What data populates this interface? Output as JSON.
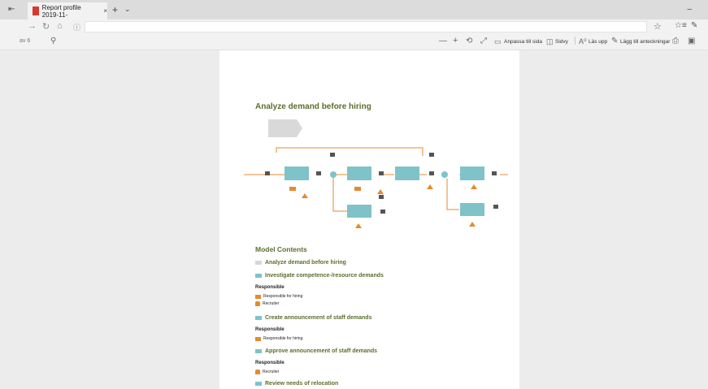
{
  "browser": {
    "tab_title": "Report profile 2019-11-",
    "tab_close": "×",
    "new_tab": "+",
    "tab_list": "⌄",
    "minimize": "–"
  },
  "pdf_toolbar": {
    "page_indicator": "av 6",
    "zoom_out": "—",
    "zoom_in": "+",
    "rotate": "⟲",
    "fit_label": "Anpassa till sida",
    "layout_label": "Sidvy",
    "read_aloud_label": "Läs upp",
    "annotations_label": "Lägg till anteckningar"
  },
  "document": {
    "title": "Analyze demand before hiring",
    "model_contents_heading": "Model Contents",
    "colors": {
      "heading": "#5a6e2c",
      "process": "#d6d6d6",
      "activity": "#7fc3c9",
      "person": "#e58a2e"
    },
    "items": [
      {
        "label": "Analyze demand before hiring",
        "kind": "process"
      },
      {
        "label": "Investigate competence-/resource demands",
        "kind": "activity",
        "responsible_heading": "Responsible",
        "responsible": [
          "Responsible for hiring",
          "Recruiter"
        ]
      },
      {
        "label": "Create announcement of staff demands",
        "kind": "activity",
        "responsible_heading": "Responsible",
        "responsible": [
          "Responsible for hiring"
        ]
      },
      {
        "label": "Approve announcement of staff demands",
        "kind": "activity",
        "responsible_heading": "Responsible",
        "responsible": [
          "Recruiter"
        ]
      },
      {
        "label": "Review needs of relocation",
        "kind": "activity"
      }
    ]
  }
}
